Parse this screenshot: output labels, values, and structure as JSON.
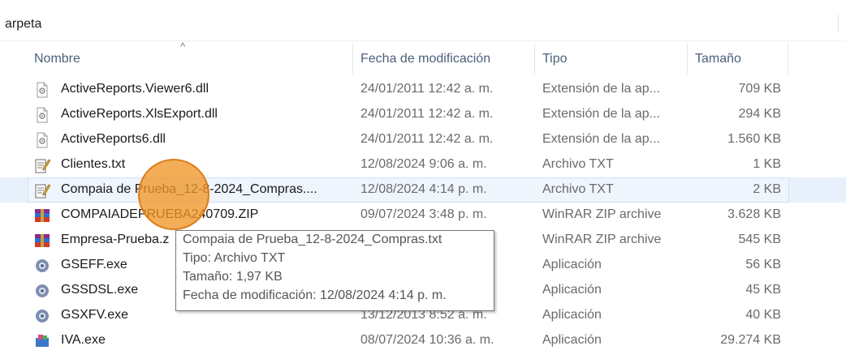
{
  "breadcrumb": {
    "text": "arpeta"
  },
  "columns": {
    "name": "Nombre",
    "date": "Fecha de modificación",
    "type": "Tipo",
    "size": "Tamaño"
  },
  "files": [
    {
      "name": "ActiveReports.Viewer6.dll",
      "date": "24/01/2011 12:42 a. m.",
      "type": "Extensión de la ap...",
      "size": "709 KB",
      "icon": "dll-file-icon"
    },
    {
      "name": "ActiveReports.XlsExport.dll",
      "date": "24/01/2011 12:42 a. m.",
      "type": "Extensión de la ap...",
      "size": "294 KB",
      "icon": "dll-file-icon"
    },
    {
      "name": "ActiveReports6.dll",
      "date": "24/01/2011 12:42 a. m.",
      "type": "Extensión de la ap...",
      "size": "1.560 KB",
      "icon": "dll-file-icon"
    },
    {
      "name": "Clientes.txt",
      "date": "12/08/2024 9:06 a. m.",
      "type": "Archivo TXT",
      "size": "1 KB",
      "icon": "text-file-icon"
    },
    {
      "name": "Compaia de Prueba_12-8-2024_Compras....",
      "date": "12/08/2024 4:14 p. m.",
      "type": "Archivo TXT",
      "size": "2 KB",
      "icon": "text-file-icon"
    },
    {
      "name": "COMPAIADEPRUEBA240709.ZIP",
      "date": "09/07/2024 3:48 p. m.",
      "type": "WinRAR ZIP archive",
      "size": "3.628 KB",
      "icon": "winrar-icon"
    },
    {
      "name": "Empresa-Prueba.z",
      "date": "n.",
      "type": "WinRAR ZIP archive",
      "size": "545 KB",
      "icon": "winrar-icon"
    },
    {
      "name": "GSEFF.exe",
      "date": "n.",
      "type": "Aplicación",
      "size": "56 KB",
      "icon": "gear-app-icon"
    },
    {
      "name": "GSSDSL.exe",
      "date": "n.",
      "type": "Aplicación",
      "size": "45 KB",
      "icon": "gear-app-icon"
    },
    {
      "name": "GSXFV.exe",
      "date": "13/12/2013 8:52 a. m.",
      "type": "Aplicación",
      "size": "40 KB",
      "icon": "gear-app-icon"
    },
    {
      "name": "IVA.exe",
      "date": "08/07/2024 10:36 a. m.",
      "type": "Aplicación",
      "size": "29.274 KB",
      "icon": "app-icon"
    }
  ],
  "tooltip": {
    "line1": "Compaia de Prueba_12-8-2024_Compras.txt",
    "line2": "Tipo: Archivo TXT",
    "line3": "Tamaño: 1,97 KB",
    "line4": "Fecha de modificación: 12/08/2024 4:14 p. m."
  },
  "hovered_index": 4
}
